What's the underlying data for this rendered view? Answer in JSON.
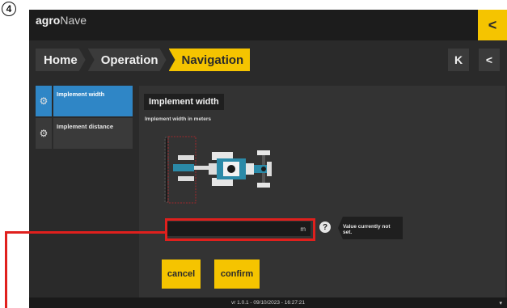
{
  "step_badge": "4",
  "brand": {
    "bold": "agro",
    "rest": "Nave"
  },
  "header": {
    "back_icon": "chevron-left-icon",
    "back_symbol": "<"
  },
  "breadcrumb": [
    {
      "label": "Home"
    },
    {
      "label": "Operation"
    },
    {
      "label": "Navigation"
    }
  ],
  "nav": {
    "first_label": "K",
    "back_label": "<"
  },
  "menu": [
    {
      "label": "Implement width",
      "icon": "gear-icon",
      "active": true
    },
    {
      "label": "Implement distance",
      "icon": "gear-icon",
      "active": false
    }
  ],
  "panel": {
    "title": "Implement width",
    "subtitle": "Implement width in meters",
    "input_value": "",
    "input_unit": "m",
    "help_label": "?",
    "tooltip": "Value currently not set."
  },
  "buttons": {
    "cancel": "cancel",
    "confirm": "confirm"
  },
  "footer": {
    "version": "vr 1.0.1 - 09/10/2023 - 16:27:21"
  },
  "colors": {
    "accent": "#f5c400",
    "selected": "#2f86c6",
    "highlight": "#e0201d",
    "implement": "#2b8aa8"
  }
}
